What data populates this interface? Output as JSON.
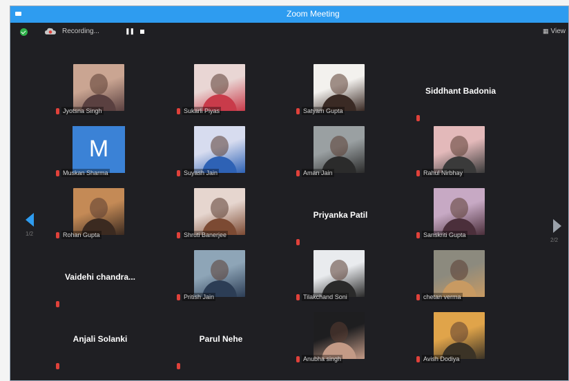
{
  "window": {
    "title": "Zoom Meeting"
  },
  "toolbar": {
    "recording_label": "Recording...",
    "pause_label": "❚❚",
    "view_label": "View"
  },
  "colors": {
    "titlebar": "#2e9cf0",
    "background": "#1f1f23",
    "muted_mic": "#e0413a",
    "avatar_m": "#3b82d6"
  },
  "participants": [
    {
      "name": "Jyotsna Singh",
      "type": "video"
    },
    {
      "name": "Sukarli Piyas",
      "type": "video"
    },
    {
      "name": "Satyam Gupta",
      "type": "video"
    },
    {
      "name": "Siddhant Badonia",
      "type": "name"
    },
    {
      "name": "Muskan Sharma",
      "type": "avatar",
      "initial": "M"
    },
    {
      "name": "Suyash Jain",
      "type": "video"
    },
    {
      "name": "Aman Jain",
      "type": "video"
    },
    {
      "name": "Rahul Nirbhay",
      "type": "video"
    },
    {
      "name": "Rohan Gupta",
      "type": "video"
    },
    {
      "name": "Shruti Banerjee",
      "type": "video"
    },
    {
      "name": "Priyanka Patil",
      "type": "name"
    },
    {
      "name": "Sanskriti Gupta",
      "type": "video"
    },
    {
      "name": "Vaidehi chandra...",
      "type": "name"
    },
    {
      "name": "Pritish Jain",
      "type": "video"
    },
    {
      "name": "Tilakchand Soni",
      "type": "video"
    },
    {
      "name": "chetan verma",
      "type": "video"
    },
    {
      "name": "Anjali Solanki",
      "type": "name"
    },
    {
      "name": "Parul Nehe",
      "type": "name"
    },
    {
      "name": "Anubha singh",
      "type": "video"
    },
    {
      "name": "Avish Dodiya",
      "type": "video"
    }
  ],
  "pagination": {
    "left": "1/2",
    "right": "2/2"
  }
}
